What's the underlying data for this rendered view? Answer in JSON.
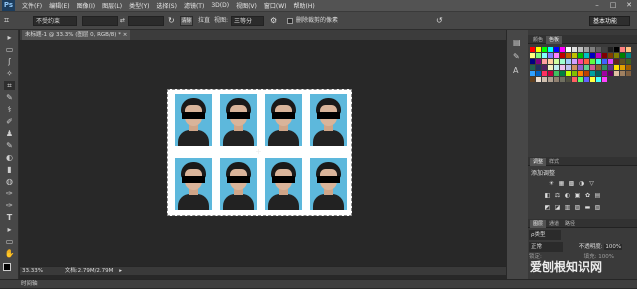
{
  "app": {
    "logo": "Ps"
  },
  "menu": [
    "文件(F)",
    "编辑(E)",
    "图像(I)",
    "图层(L)",
    "类型(Y)",
    "选择(S)",
    "滤镜(T)",
    "3D(D)",
    "视图(V)",
    "窗口(W)",
    "帮助(H)"
  ],
  "window_controls": [
    "–",
    "□",
    "✕"
  ],
  "options": {
    "preset": "不受约束",
    "width_value": "",
    "swap": "⇄",
    "height_value": "",
    "clear_label": "清除",
    "straighten_label": "拉直",
    "view_label": "视图:",
    "view_value": "三等分",
    "delete_cropped_label": "删除裁剪的像素",
    "undo_icon": "↺",
    "workspace": "基本功能"
  },
  "document_tab": {
    "label": "未标题-1 @ 33.3% (图层 0, RGB/8) *",
    "close": "×"
  },
  "tools": [
    "▸",
    "▭",
    "ʃ",
    "✧",
    "⌗",
    "✎",
    "⚕",
    "✐",
    "♟",
    "✎",
    "◐",
    "▮",
    "◍",
    "✑",
    "T",
    "▸",
    "▭",
    "✋",
    "🔍",
    "■"
  ],
  "status": {
    "zoom": "33.33%",
    "doc_info": "文档:2.79M/2.79M"
  },
  "timeline_label": "时间轴",
  "panels": {
    "color_tabs": [
      "颜色",
      "色板"
    ],
    "adjust_tabs": [
      "调整",
      "样式"
    ],
    "adjust_title": "添加调整",
    "layer_tabs": [
      "图层",
      "通道",
      "路径"
    ],
    "layer_kind": "ρ类型",
    "blend_mode": "正常",
    "opacity_label": "不透明度:",
    "opacity_value": "100%",
    "lock_label": "锁定:",
    "fill_label": "填充:",
    "fill_value": "100%"
  },
  "swatch_colors": [
    "#ff0000",
    "#ffff00",
    "#00ff00",
    "#00ffff",
    "#0000ff",
    "#ff00ff",
    "#ffffff",
    "#e0e0e0",
    "#c0c0c0",
    "#a0a0a0",
    "#808080",
    "#606060",
    "#404040",
    "#202020",
    "#000000",
    "#ff8080",
    "#ffc080",
    "#ffff80",
    "#80ff80",
    "#80ffff",
    "#8080ff",
    "#ff80ff",
    "#c00000",
    "#c06000",
    "#c0c000",
    "#00c000",
    "#00c0c0",
    "#0000c0",
    "#c000c0",
    "#800000",
    "#804000",
    "#808000",
    "#008000",
    "#008080",
    "#000080",
    "#800080",
    "#ffa0a0",
    "#ffd0a0",
    "#d0ffa0",
    "#a0ffd0",
    "#a0d0ff",
    "#d0a0ff",
    "#ff40a0",
    "#ff6040",
    "#60ff40",
    "#40ffe0",
    "#4060ff",
    "#e040ff",
    "#602020",
    "#605020",
    "#406020",
    "#206050",
    "#203060",
    "#502060",
    "#f0f0c0",
    "#c0f0f0",
    "#f0c0f0",
    "#c0c0f0",
    "#d09060",
    "#9060d0",
    "#60d090",
    "#d06090",
    "#906030",
    "#309060",
    "#603090",
    "#ffe000",
    "#e0a000",
    "#a06000",
    "#30a0ff",
    "#0060c0",
    "#ff3060",
    "#c00040",
    "#40c060",
    "#008040",
    "#c0ff00",
    "#80c000",
    "#ff8000",
    "#c04000",
    "#00a0a0",
    "#006060",
    "#a000a0",
    "#600060",
    "#e0c0a0",
    "#a08060",
    "#806040",
    "#604020",
    "#f0e0d0",
    "#d0c0b0",
    "#b0a090",
    "#908070",
    "#707060",
    "#505040",
    "#ff6060",
    "#60ff60",
    "#6060ff",
    "#ffff40",
    "#40ffff",
    "#ff40ff"
  ],
  "adjust_icons_row1": [
    "☀",
    "▦",
    "▩",
    "◑",
    "▽"
  ],
  "adjust_icons_row2": [
    "◧",
    "⚖",
    "◐",
    "▣",
    "✿",
    "▤"
  ],
  "adjust_icons_row3": [
    "◩",
    "◪",
    "▥",
    "▨",
    "▬",
    "▧"
  ],
  "watermark": "爱刨根知识网"
}
